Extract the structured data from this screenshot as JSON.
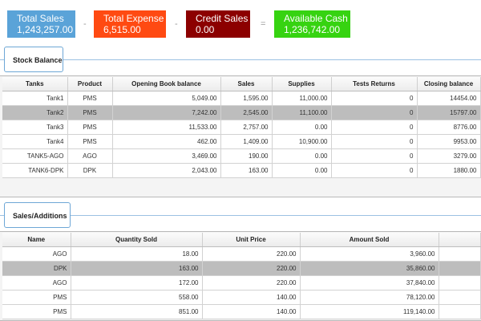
{
  "summary": {
    "total_sales": {
      "label": "Total Sales",
      "value": "1,243,257.00",
      "color": "#5aa3d8"
    },
    "total_expense": {
      "label": "Total Expense",
      "value": "6,515.00",
      "color": "#ff4a12"
    },
    "credit_sales": {
      "label": "Credit Sales",
      "value": "0.00",
      "color": "#8c0000"
    },
    "available_cash": {
      "label": "Available Cash",
      "value": "1,236,742.00",
      "color": "#36d311"
    },
    "op_minus": "-",
    "op_equals": "="
  },
  "stock_balance": {
    "title": "Stock Balance",
    "columns": [
      "Tanks",
      "Product",
      "Opening Book balance",
      "Sales",
      "Supplies",
      "Tests Returns",
      "Closing balance"
    ],
    "rows": [
      [
        "Tank1",
        "PMS",
        "5,049.00",
        "1,595.00",
        "11,000.00",
        "0",
        "14454.00"
      ],
      [
        "Tank2",
        "PMS",
        "7,242.00",
        "2,545.00",
        "11,100.00",
        "0",
        "15797.00"
      ],
      [
        "Tank3",
        "PMS",
        "11,533.00",
        "2,757.00",
        "0.00",
        "0",
        "8776.00"
      ],
      [
        "Tank4",
        "PMS",
        "462.00",
        "1,409.00",
        "10,900.00",
        "0",
        "9953.00"
      ],
      [
        "TANK5-AGO",
        "AGO",
        "3,469.00",
        "190.00",
        "0.00",
        "0",
        "3279.00"
      ],
      [
        "TANK6-DPK",
        "DPK",
        "2,043.00",
        "163.00",
        "0.00",
        "0",
        "1880.00"
      ]
    ],
    "selected_row": 1
  },
  "sales_additions": {
    "title": "Sales/Additions",
    "columns": [
      "Name",
      "Quantity Sold",
      "Unit Price",
      "Amount Sold"
    ],
    "rows": [
      [
        "AGO",
        "18.00",
        "220.00",
        "3,960.00"
      ],
      [
        "DPK",
        "163.00",
        "220.00",
        "35,860.00"
      ],
      [
        "AGO",
        "172.00",
        "220.00",
        "37,840.00"
      ],
      [
        "PMS",
        "558.00",
        "140.00",
        "78,120.00"
      ],
      [
        "PMS",
        "851.00",
        "140.00",
        "119,140.00"
      ]
    ],
    "selected_row": 1
  }
}
